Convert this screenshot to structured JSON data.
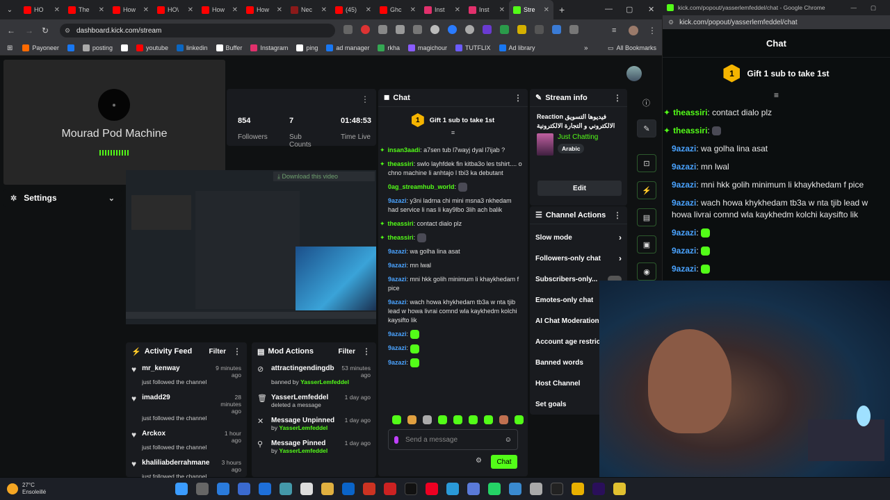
{
  "browser_left": {
    "tabs": [
      {
        "label": "HO",
        "color": "#ff0000"
      },
      {
        "label": "The",
        "color": "#ff0000"
      },
      {
        "label": "How",
        "color": "#ff0000"
      },
      {
        "label": "HO\\",
        "color": "#ff0000"
      },
      {
        "label": "How",
        "color": "#ff0000"
      },
      {
        "label": "How",
        "color": "#ff0000"
      },
      {
        "label": "Nec",
        "color": "#8b1a1a"
      },
      {
        "label": "(45)",
        "color": "#ff0000"
      },
      {
        "label": "Ghc",
        "color": "#ff0000"
      },
      {
        "label": "Inst",
        "color": "#e1306c"
      },
      {
        "label": "Inst",
        "color": "#e1306c"
      },
      {
        "label": "Stre",
        "color": "#53fc18"
      }
    ],
    "url": "dashboard.kick.com/stream",
    "bookmarks": [
      {
        "label": "Payoneer",
        "color": "#ff6a00"
      },
      {
        "label": "",
        "color": "#1877f2"
      },
      {
        "label": "posting",
        "color": "#aaaaaa"
      },
      {
        "label": "",
        "color": "#ffffff"
      },
      {
        "label": "youtube",
        "color": "#ff0000"
      },
      {
        "label": "linkedin",
        "color": "#0a66c2"
      },
      {
        "label": "Buffer",
        "color": "#ffffff"
      },
      {
        "label": "Instagram",
        "color": "#e1306c"
      },
      {
        "label": "ping",
        "color": "#ffffff"
      },
      {
        "label": "ad manager",
        "color": "#1877f2"
      },
      {
        "label": "rkha",
        "color": "#34a853"
      },
      {
        "label": "magichour",
        "color": "#8a5cff"
      },
      {
        "label": "TUTFLIX",
        "color": "#6b5bff"
      },
      {
        "label": "Ad library",
        "color": "#1877f2"
      }
    ],
    "all_bookmarks": "All Bookmarks"
  },
  "dashboard": {
    "webcam_name": "Mourad Pod Machine",
    "settings_label": "Settings",
    "stats": [
      {
        "value": "854",
        "label": "Followers"
      },
      {
        "value": "7",
        "label": "Sub Counts"
      },
      {
        "value": "01:48:53",
        "label": "Time Live"
      }
    ],
    "download_label": "Download this video",
    "chat": {
      "title": "Chat",
      "gift": "Gift 1 sub to take 1st",
      "messages": [
        {
          "user": "insan3aadi",
          "text": "a7sen tub l7wayj dyal l7ijab ?",
          "color": "green",
          "badge": true
        },
        {
          "user": "theassiri",
          "text": "swlo layhfdek fin kitba3o les tshirt.... o chno machine li anhtajo l tbi3 ka debutant",
          "color": "green",
          "badge": true
        },
        {
          "user": "0ag_streamhub_world",
          "text": "",
          "color": "green",
          "badge": false,
          "emote": true
        },
        {
          "user": "9azazi",
          "text": "y3ni ladrna chi mini msna3 nkhedam had service li nas li kay9lbo 3lih ach balik",
          "color": "blue",
          "badge": false
        },
        {
          "user": "theassiri",
          "text": "contact dialo plz",
          "color": "green",
          "badge": true
        },
        {
          "user": "theassiri",
          "text": "",
          "color": "green",
          "badge": true,
          "emote": true
        },
        {
          "user": "9azazi",
          "text": "wa golha lina asat",
          "color": "blue",
          "badge": false
        },
        {
          "user": "9azazi",
          "text": "mn lwal",
          "color": "blue",
          "badge": false
        },
        {
          "user": "9azazi",
          "text": "mni hkk golih minimum li khaykhedam f pice",
          "color": "blue",
          "badge": false
        },
        {
          "user": "9azazi",
          "text": "wach howa khykhedam tb3a w nta tjib lead w howa livrai comnd wla kaykhedm kolchi kaysifto lik",
          "color": "blue",
          "badge": false
        },
        {
          "user": "9azazi",
          "text": "",
          "color": "blue",
          "badge": false,
          "emote": true
        },
        {
          "user": "9azazi",
          "text": "",
          "color": "blue",
          "badge": false,
          "emote": true
        },
        {
          "user": "9azazi",
          "text": "",
          "color": "blue",
          "badge": false,
          "emote": true
        }
      ],
      "input_placeholder": "Send a message",
      "send_label": "Chat"
    },
    "stream_info": {
      "title": "Stream info",
      "stream_title": "Reaction فيديوها التسويق الالكتروني و التجارة الالكترونية",
      "category": "Just Chatting",
      "language": "Arabic",
      "edit_label": "Edit"
    },
    "channel_actions": {
      "title": "Channel Actions",
      "items": [
        "Slow mode",
        "Followers-only chat",
        "Subscribers-only...",
        "Emotes-only chat",
        "AI Chat Moderation",
        "Account age restric",
        "Banned words",
        "Host Channel",
        "Set goals"
      ]
    },
    "activity_feed": {
      "title": "Activity Feed",
      "filter": "Filter",
      "items": [
        {
          "user": "mr_kenway",
          "time": "9 minutes ago",
          "action": "just followed the channel"
        },
        {
          "user": "imadd29",
          "time": "28 minutes ago",
          "action": "just followed the channel"
        },
        {
          "user": "Arckox",
          "time": "1 hour ago",
          "action": "just followed the channel"
        },
        {
          "user": "khaliliabderrahmane",
          "time": "3 hours ago",
          "action": "just followed the channel"
        }
      ]
    },
    "mod_actions": {
      "title": "Mod Actions",
      "filter": "Filter",
      "items": [
        {
          "title": "attractingendingdb",
          "time": "53 minutes ago",
          "sub_prefix": "banned by ",
          "sub_user": "YasserLemfeddel"
        },
        {
          "title": "YasserLemfeddel",
          "time": "1 day ago",
          "sub_prefix": "deleted a message",
          "sub_user": ""
        },
        {
          "title": "Message Unpinned",
          "time": "1 day ago",
          "sub_prefix": "by ",
          "sub_user": "YasserLemfeddel"
        },
        {
          "title": "Message Pinned",
          "time": "1 day ago",
          "sub_prefix": "by ",
          "sub_user": "YasserLemfeddel"
        }
      ]
    }
  },
  "browser_right": {
    "window_title": "kick.com/popout/yasserlemfeddel/chat - Google Chrome",
    "url": "kick.com/popout/yasserlemfeddel/chat",
    "chat_title": "Chat",
    "gift": "Gift 1 sub to take 1st",
    "messages": [
      {
        "user": "theassiri",
        "text": "contact dialo plz",
        "color": "green",
        "badge": true
      },
      {
        "user": "theassiri",
        "text": "",
        "color": "green",
        "badge": true,
        "emote": true
      },
      {
        "user": "9azazi",
        "text": "wa golha lina asat",
        "color": "blue",
        "badge": false
      },
      {
        "user": "9azazi",
        "text": "mn lwal",
        "color": "blue",
        "badge": false
      },
      {
        "user": "9azazi",
        "text": "mni hkk golih minimum li khaykhedam f pice",
        "color": "blue",
        "badge": false
      },
      {
        "user": "9azazi",
        "text": "wach howa khykhedam tb3a w nta tjib lead w howa livrai comnd wla kaykhedm kolchi kaysifto lik",
        "color": "blue",
        "badge": false
      },
      {
        "user": "9azazi",
        "text": "",
        "color": "blue",
        "badge": false,
        "emote": true
      },
      {
        "user": "9azazi",
        "text": "",
        "color": "blue",
        "badge": false,
        "emote": true
      },
      {
        "user": "9azazi",
        "text": "",
        "color": "blue",
        "badge": false,
        "emote": true
      }
    ]
  },
  "taskbar": {
    "weather_temp": "27°C",
    "weather_desc": "Ensoleillé"
  },
  "colors": {
    "accent": "#53fc18",
    "user_blue": "#4aa3ff"
  }
}
